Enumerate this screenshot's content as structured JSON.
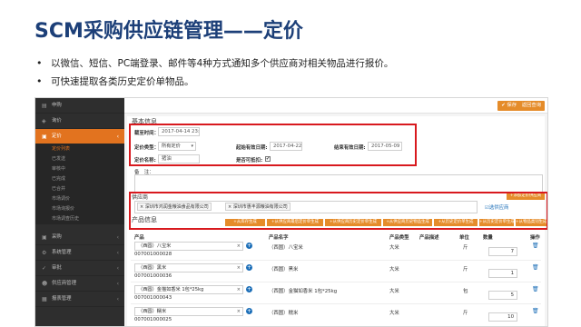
{
  "slide": {
    "title": "SCM采购供应链管理——定价",
    "bullets": [
      "以微信、短信、PC端登录、邮件等4种方式通知多个供应商对相关物品进行报价。",
      "可快速提取各类历史定价单物品。"
    ]
  },
  "sidebar": {
    "items": [
      {
        "label": "申购",
        "icon": "document-icon"
      },
      {
        "label": "询价",
        "icon": "tag-icon"
      },
      {
        "label": "定价",
        "icon": "cart-icon",
        "active": true
      }
    ],
    "subitems": [
      {
        "label": "定价列表",
        "current": true
      },
      {
        "label": "已发送"
      },
      {
        "label": "审核中"
      },
      {
        "label": "已完成"
      },
      {
        "label": "已合并"
      },
      {
        "label": "市场调价"
      },
      {
        "label": "市场询报价"
      },
      {
        "label": "市场调查历史"
      }
    ],
    "bottom_items": [
      {
        "label": "采购",
        "icon": "cart-icon"
      },
      {
        "label": "系统管理",
        "icon": "gear-icon"
      },
      {
        "label": "审批",
        "icon": "check-icon"
      },
      {
        "label": "供应商管理",
        "icon": "users-icon"
      },
      {
        "label": "报表管理",
        "icon": "chart-icon"
      }
    ]
  },
  "toolbar": {
    "save_label": "✔ 保存",
    "back_label": "返回查询"
  },
  "basic_info": {
    "section_title": "基本信息",
    "cutoff_label": "截至时间：",
    "cutoff_value": "2017-04-14 23:",
    "pricing_type_label": "定价类型：",
    "pricing_type_value": "所有定价",
    "start_date_label": "起始有效日期:",
    "start_date_value": "2017-04-22",
    "end_date_label": "结束有效日期:",
    "end_date_value": "2017-05-09",
    "pricing_name_label": "定价名称:",
    "pricing_name_value": "猪油",
    "deductible_label": "是否可抵扣:",
    "deductible_checked": "✔",
    "remark_label": "备　注："
  },
  "supplier": {
    "section_title": "供应商",
    "supplier_tags": [
      "深圳市鸿润金粮油食品有限公司",
      "深圳市惠丰源粮油有限公司"
    ],
    "add_supplier_link": "选供应商",
    "pricing_supplier_btn": "+添加定价供应商"
  },
  "products": {
    "section_title": "产品信息",
    "generate_buttons": [
      "+从库存生成",
      "+从供应商最后定价单生成",
      "+从供应商历史定价单生成",
      "+从供应商历史物品生成",
      "+从历史定价单生成",
      "+从历史定价单生成",
      "+从物品类别生成"
    ],
    "columns": [
      "产品",
      "产品名字",
      "产品类型",
      "产品描述",
      "单位",
      "数量",
      "操作"
    ],
    "rows": [
      {
        "select": "（西圆）八宝米",
        "code": "007001000028",
        "name": "（西圆）八宝米",
        "type": "大米",
        "unit": "斤",
        "qty": "7"
      },
      {
        "select": "（西圆）黑米",
        "code": "007001000036",
        "name": "（西圆）黑米",
        "type": "大米",
        "unit": "斤",
        "qty": "1"
      },
      {
        "select": "（西圆）金猫如香米 1包*25kg",
        "code": "007001000043",
        "name": "（西圆）金猫如香米 1包*25kg",
        "type": "大米",
        "unit": "包",
        "qty": "5"
      },
      {
        "select": "（西圆）糯米",
        "code": "007001000025",
        "name": "（西圆）糯米",
        "type": "大米",
        "unit": "斤",
        "qty": "10"
      }
    ]
  },
  "colors": {
    "accent": "#e58c2a",
    "highlight": "#d8191e",
    "title": "#1c3f78",
    "sidebar": "#2e2e2e"
  }
}
